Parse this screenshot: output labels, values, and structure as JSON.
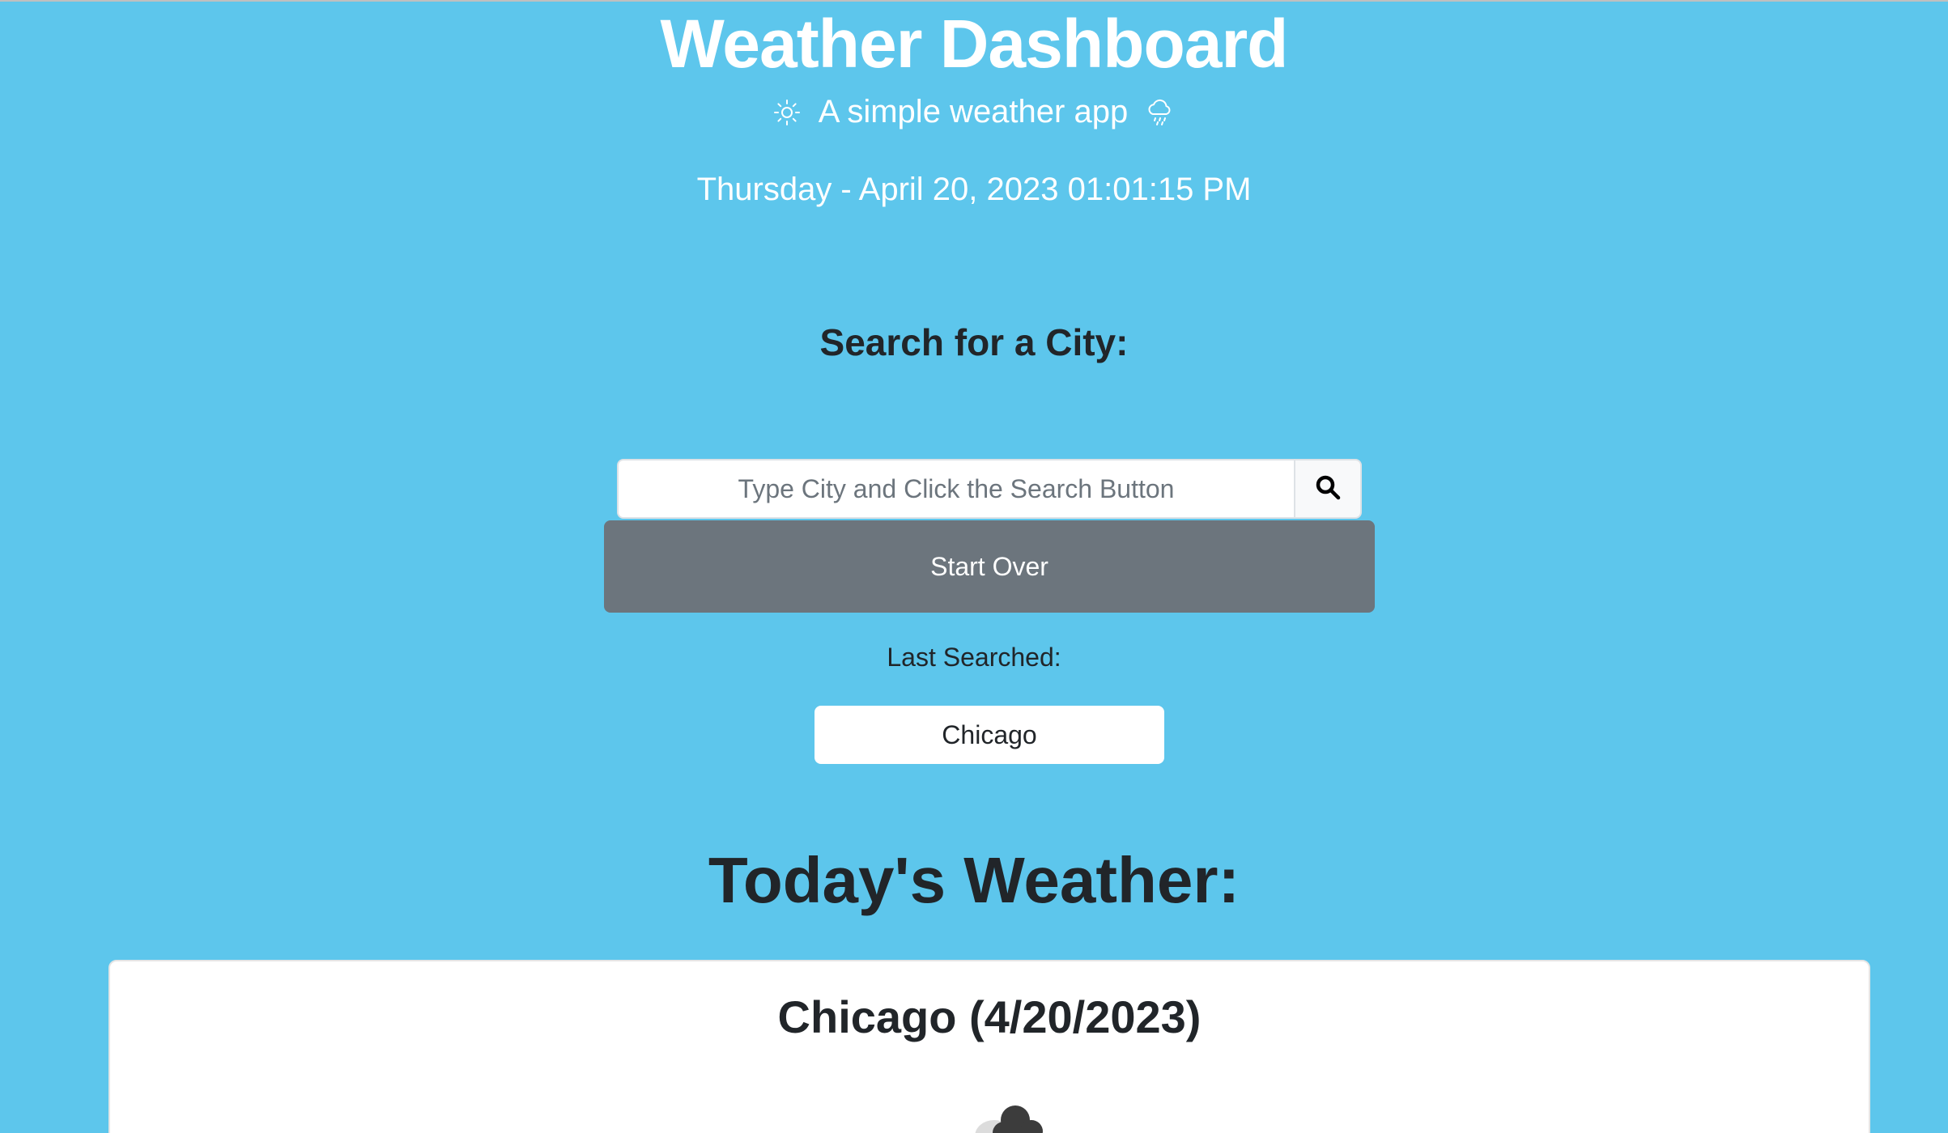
{
  "header": {
    "title": "Weather Dashboard",
    "subtitle": "A simple weather app",
    "datetime": "Thursday - April 20, 2023 01:01:15 PM"
  },
  "search": {
    "heading": "Search for a City:",
    "placeholder": "Type City and Click the Search Button",
    "value": "",
    "button_icon": "search-icon",
    "start_over_label": "Start Over"
  },
  "history": {
    "label": "Last Searched:",
    "items": [
      "Chicago"
    ]
  },
  "today": {
    "heading": "Today's Weather:",
    "card_title": "Chicago (4/20/2023)",
    "icon": "cloud-icon"
  },
  "colors": {
    "background": "#5dc6ec",
    "button_secondary": "#6c757d",
    "text_dark": "#212529",
    "text_light": "#ffffff"
  }
}
